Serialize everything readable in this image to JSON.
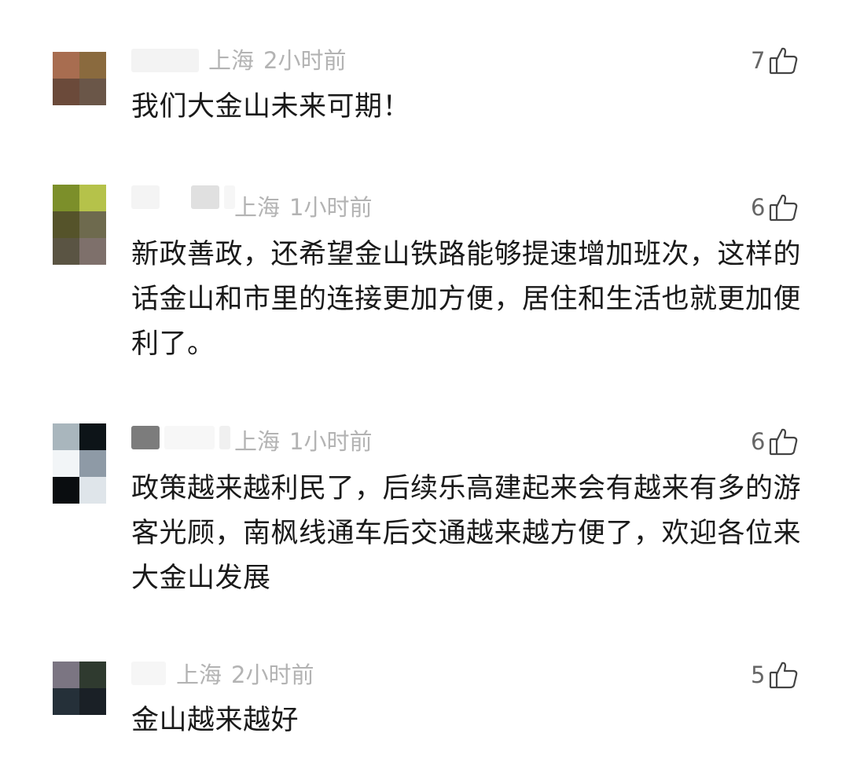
{
  "comments": [
    {
      "location": "上海",
      "time": "2小时前",
      "likes": "7",
      "text": "我们大金山未来可期！",
      "avatar_colors": [
        "#a86d50",
        "#8a6a3e",
        "#6b4a3a",
        "#6a5648"
      ]
    },
    {
      "location": "上海",
      "time": "1小时前",
      "likes": "6",
      "text": "新政善政，还希望金山铁路能够提速增加班次，这样的话金山和市里的连接更加方便，居住和生活也就更加便利了。",
      "avatar_colors": [
        "#7c8f2a",
        "#b5c24a",
        "#55532a",
        "#6e6a4e",
        "#5a5443",
        "#7e706b"
      ]
    },
    {
      "location": "上海",
      "time": "1小时前",
      "likes": "6",
      "text": "政策越来越利民了，后续乐高建起来会有越来有多的游客光顾，南枫线通车后交通越来越方便了，欢迎各位来大金山发展",
      "avatar_colors": [
        "#a9b6bd",
        "#0d1418",
        "#f2f5f7",
        "#8e9aa6",
        "#0a0d10",
        "#dfe5ea"
      ]
    },
    {
      "location": "上海",
      "time": "2小时前",
      "likes": "5",
      "text": "金山越来越好",
      "avatar_colors": [
        "#7b7582",
        "#2f3a2f",
        "#253039",
        "#1a2026"
      ]
    }
  ],
  "colors": {
    "meta_gray": "#b3b3b3",
    "text": "#1a1a1a",
    "like_gray": "#666666"
  },
  "icons": {
    "like": "thumbs-up-icon"
  }
}
